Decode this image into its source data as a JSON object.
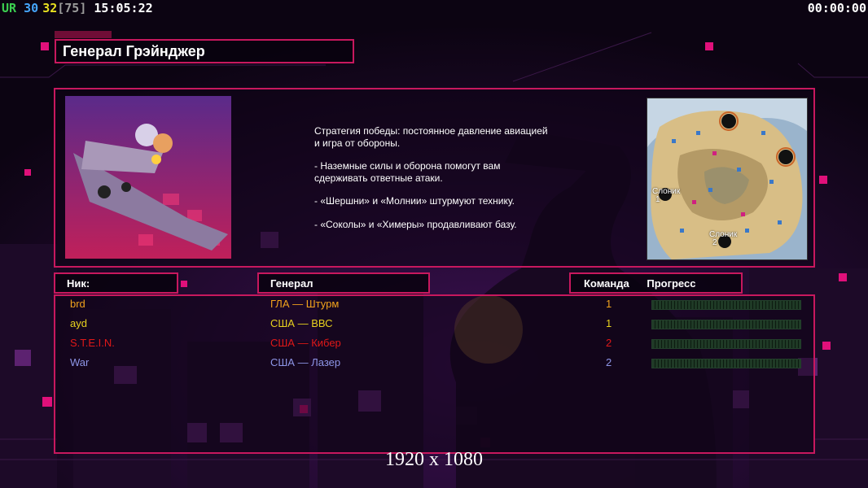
{
  "hud": {
    "tag_ur": "UR",
    "num_30": "30",
    "num_32": "32",
    "num_75": "[75]",
    "clock": "15:05:22",
    "timer": "00:00:00"
  },
  "general": {
    "title": "Генерал Грэйнджер",
    "strategy": [
      "Стратегия победы: постоянное давление авиацией\n и игра от обороны.",
      "- Наземные силы и оборона помогут вам\n сдерживать ответные атаки.",
      "- «Шершни» и «Молнии» штурмуют технику.",
      "- «Соколы» и «Химеры» продавливают базу."
    ]
  },
  "map": {
    "spawns": [
      {
        "label": "Слоник",
        "num": "1"
      },
      {
        "label": "Слоник",
        "num": "2"
      }
    ]
  },
  "table": {
    "headers": {
      "nick": "Ник:",
      "general": "Генерал",
      "team": "Команда",
      "progress": "Прогресс"
    },
    "rows": [
      {
        "nick": "brd",
        "general": "ГЛА — Штурм",
        "team": "1",
        "color": "#f0a21c",
        "progress": 0
      },
      {
        "nick": "ayd",
        "general": "США — ВВС",
        "team": "1",
        "color": "#e8d21e",
        "progress": 0
      },
      {
        "nick": "S.T.E.I.N.",
        "general": "США — Кибер",
        "team": "2",
        "color": "#e01818",
        "progress": 0
      },
      {
        "nick": "War",
        "general": "США — Лазер",
        "team": "2",
        "color": "#8e96e8",
        "progress": 0
      }
    ]
  },
  "resolution": "1920 x 1080",
  "colors": {
    "accent": "#c8185e",
    "ur": "#3cd050",
    "n30": "#46a6ff",
    "n32": "#e8e020",
    "n75": "#9a9a9a"
  }
}
